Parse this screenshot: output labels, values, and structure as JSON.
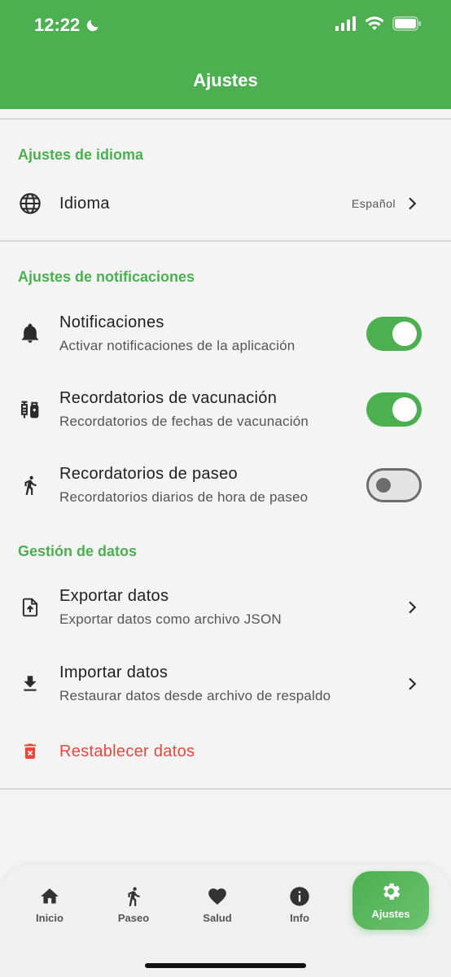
{
  "status_bar": {
    "time": "12:22"
  },
  "app_bar": {
    "title": "Ajustes"
  },
  "sections": {
    "language": {
      "title": "Ajustes de idioma",
      "idioma": {
        "label": "Idioma",
        "value": "Español"
      }
    },
    "notifications": {
      "title": "Ajustes de notificaciones",
      "notificaciones": {
        "label": "Notificaciones",
        "subtitle": "Activar notificaciones de la aplicación",
        "enabled": true
      },
      "vacunacion": {
        "label": "Recordatorios de vacunación",
        "subtitle": "Recordatorios de fechas de vacunación",
        "enabled": true
      },
      "paseo": {
        "label": "Recordatorios de paseo",
        "subtitle": "Recordatorios diarios de hora de paseo",
        "enabled": false
      }
    },
    "data": {
      "title": "Gestión de datos",
      "exportar": {
        "label": "Exportar datos",
        "subtitle": "Exportar datos como archivo JSON"
      },
      "importar": {
        "label": "Importar datos",
        "subtitle": "Restaurar datos desde archivo de respaldo"
      },
      "restablecer": {
        "label": "Restablecer datos"
      }
    }
  },
  "nav": {
    "items": [
      {
        "label": "Inicio",
        "icon": "home-icon"
      },
      {
        "label": "Paseo",
        "icon": "walk-icon"
      },
      {
        "label": "Salud",
        "icon": "heart-icon"
      },
      {
        "label": "Info",
        "icon": "info-icon"
      },
      {
        "label": "Ajustes",
        "icon": "gear-icon",
        "active": true
      }
    ]
  },
  "colors": {
    "accent": "#4caf50",
    "danger": "#e8483c"
  }
}
